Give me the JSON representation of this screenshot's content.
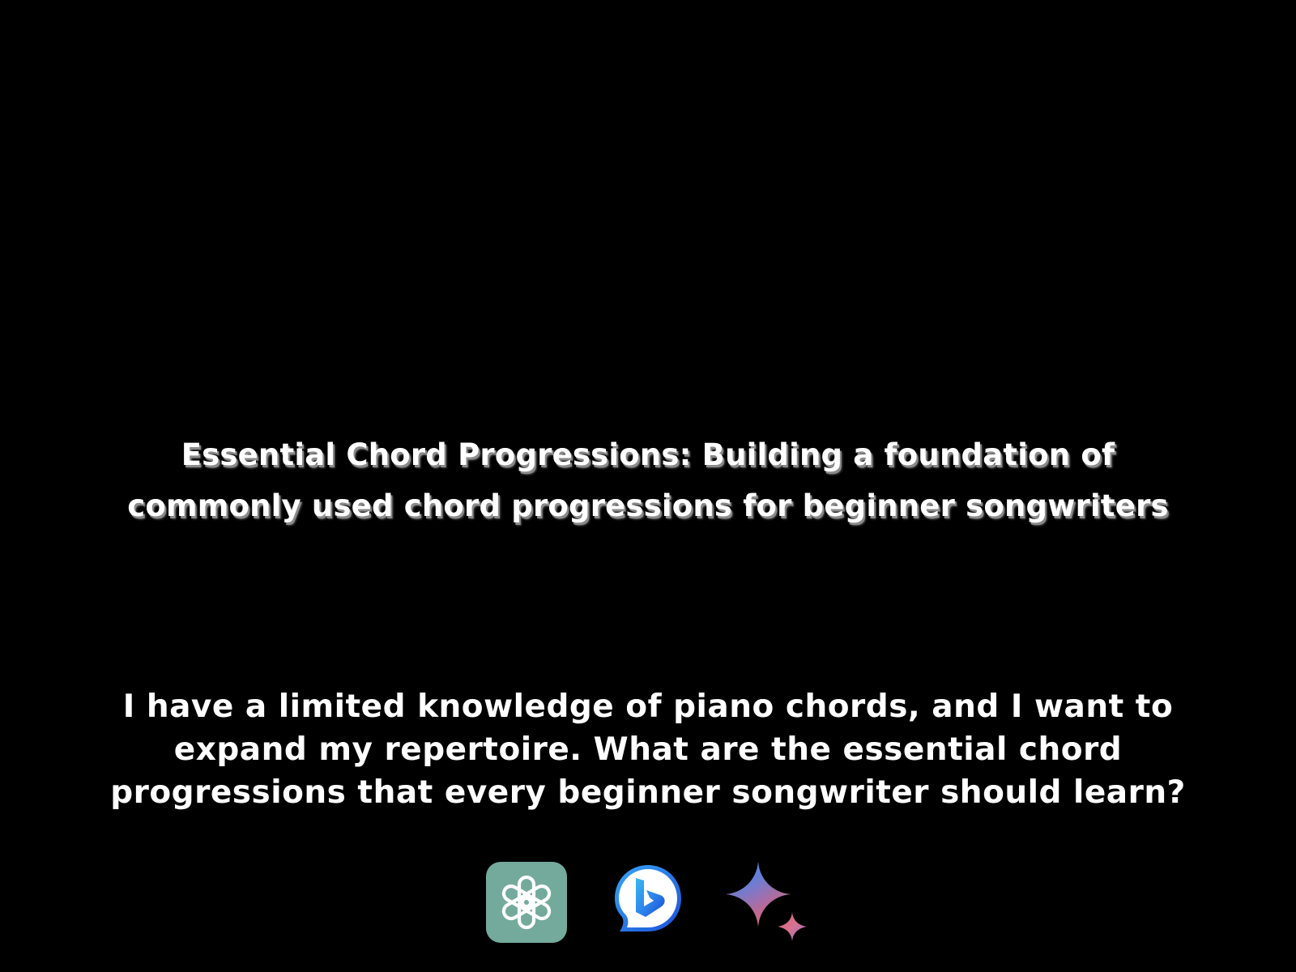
{
  "title": {
    "line1": "Essential Chord Progressions: Building a foundation of",
    "line2": "commonly used chord progressions for beginner songwriters"
  },
  "prompt": {
    "line1": "I have a limited knowledge of piano chords, and I want to",
    "line2": "expand my repertoire. What are the essential chord",
    "line3": "progressions that every beginner songwriter should learn?"
  },
  "logos": [
    {
      "icon": "chatgpt-icon",
      "color": "#74aa9c"
    },
    {
      "icon": "bing-chat-icon",
      "color": "#1b6fe0"
    },
    {
      "icon": "gemini-sparkle-icon",
      "color": "#6c7ee0"
    }
  ],
  "colors": {
    "background": "#000000",
    "text": "#ffffff"
  }
}
